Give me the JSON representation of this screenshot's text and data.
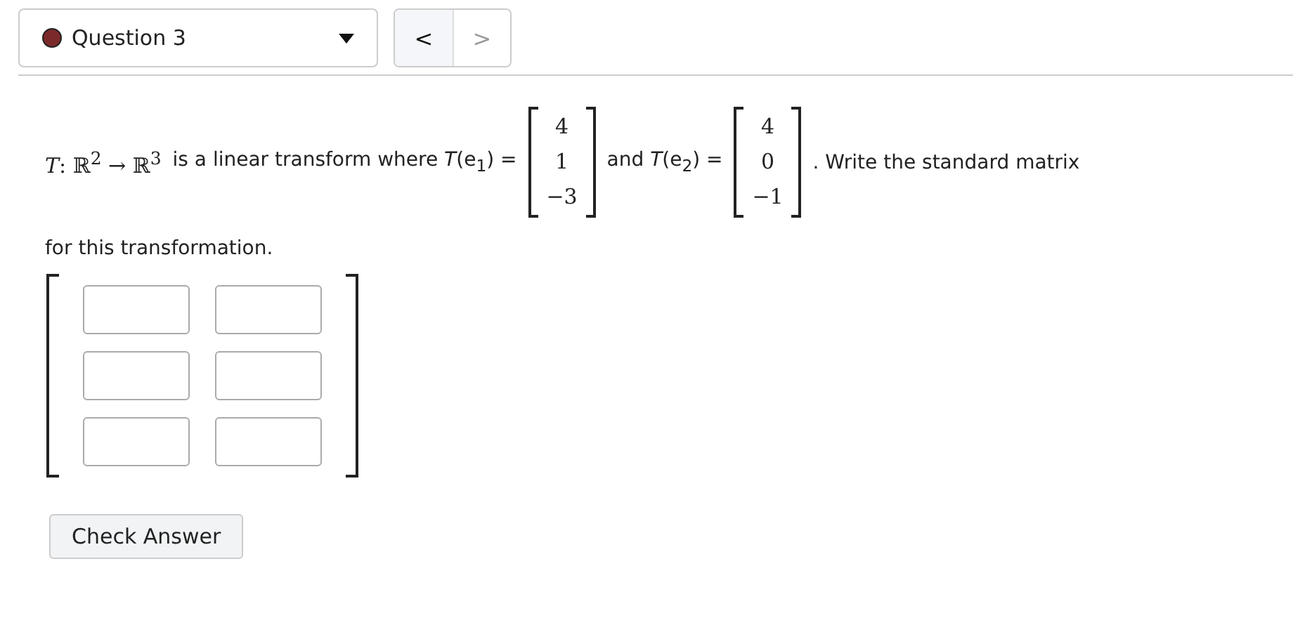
{
  "question_selector": {
    "label": "Question 3",
    "color": "#7b2a2a"
  },
  "nav": [
    {
      "symbol": "<",
      "disabled": false
    },
    {
      "symbol": ">",
      "disabled": true
    }
  ],
  "prompt": [
    {
      "kind": "math",
      "text": "*T*: ℝ$^{2}$ → ℝ$^{3}$"
    },
    {
      "kind": "text",
      "text": "is a linear transform where *T*(e$_{1}$) ="
    },
    {
      "kind": "vector",
      "entries": [
        "4",
        "1",
        "−3"
      ]
    },
    {
      "kind": "text",
      "text": "and *T*(e$_{2}$) ="
    },
    {
      "kind": "vector",
      "entries": [
        "4",
        "0",
        "−1"
      ]
    },
    {
      "kind": "text",
      "text": ". Write the standard matrix"
    }
  ],
  "prompt_continued": "for this transformation.",
  "answer_matrix": [
    [
      {
        "kind": "blank"
      },
      {
        "kind": "blank"
      }
    ],
    [
      {
        "kind": "blank"
      },
      {
        "kind": "blank"
      }
    ],
    [
      {
        "kind": "blank"
      },
      {
        "kind": "blank"
      }
    ]
  ],
  "check_button": "Check Answer"
}
